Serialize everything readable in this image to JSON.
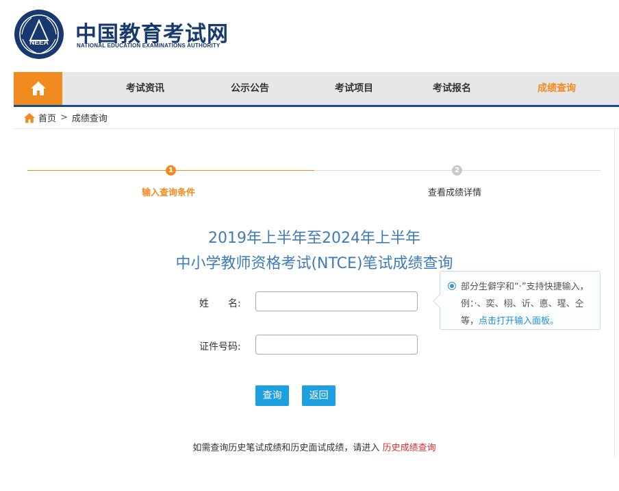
{
  "brand": {
    "seal_text": "NEEA",
    "title": "中国教育考试网",
    "subtitle": "NATIONAL EDUCATION EXAMINATIONS AUTHORITY",
    "navy": "#17396f"
  },
  "nav": {
    "home_icon": "home-icon",
    "items": [
      "考试资讯",
      "公示公告",
      "考试项目",
      "考试报名",
      "成绩查询"
    ],
    "active_index": 4,
    "accent": "#f28b1f"
  },
  "breadcrumb": {
    "home": "首页",
    "separator": ">",
    "current": "成绩查询"
  },
  "steps": [
    {
      "num": "1",
      "label": "输入查询条件",
      "state": "active"
    },
    {
      "num": "2",
      "label": "查看成绩详情",
      "state": "inactive"
    }
  ],
  "query": {
    "title_line1": "2019年上半年至2024年上半年",
    "title_line2": "中小学教师资格考试(NTCE)笔试成绩查询",
    "name_label": "姓　　名:",
    "name_value": "",
    "id_label": "证件号码:",
    "id_value": "",
    "submit": "查询",
    "back": "返回"
  },
  "tip": {
    "text": "部分生僻字和“·”支持快捷输入，例：·、奕、栩、䜣、悳、瑆、仝等，",
    "link": "点击打开输入面板。"
  },
  "footer": {
    "text": "如需查询历史笔试成绩和历史面试成绩，请进入",
    "link": "历史成绩查询"
  }
}
